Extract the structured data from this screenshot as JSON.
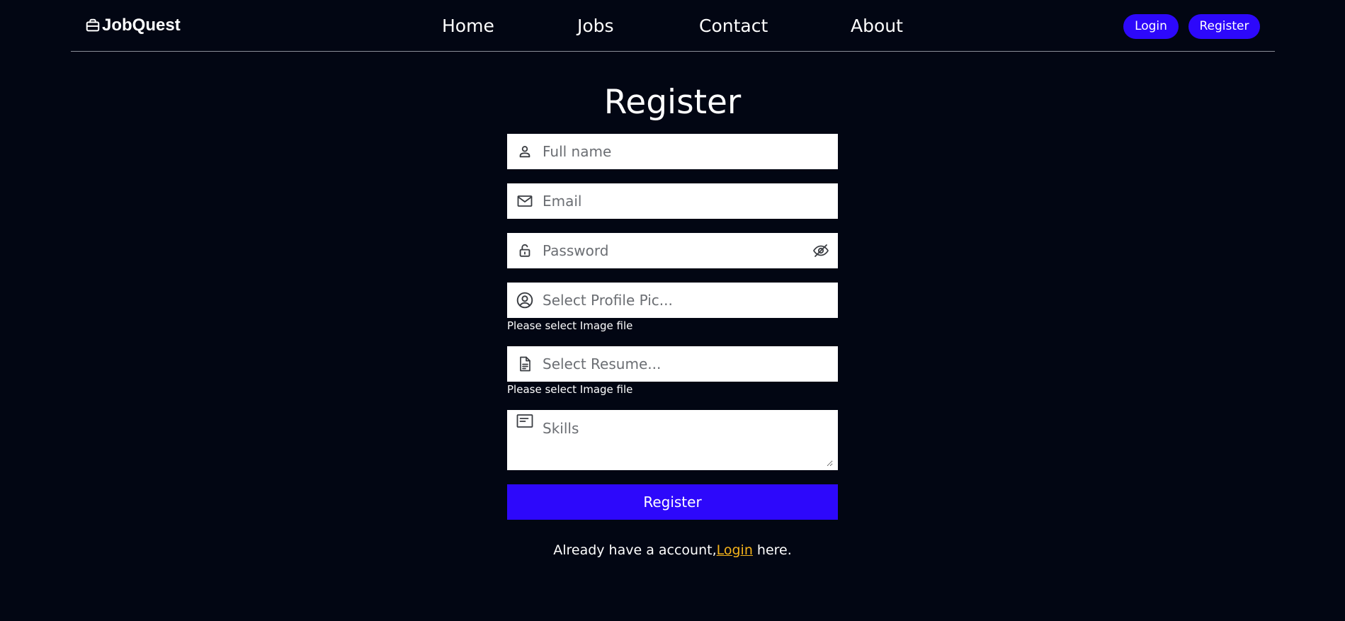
{
  "navbar": {
    "brand": "JobQuest",
    "links": [
      "Home",
      "Jobs",
      "Contact",
      "About"
    ],
    "login_label": "Login",
    "register_label": "Register"
  },
  "form": {
    "title": "Register",
    "full_name_placeholder": "Full name",
    "email_placeholder": "Email",
    "password_placeholder": "Password",
    "profile_pic_placeholder": "Select Profile Pic...",
    "profile_pic_hint": "Please select Image file",
    "resume_placeholder": "Select Resume...",
    "resume_hint": "Please select Image file",
    "skills_placeholder": "Skills",
    "submit_label": "Register",
    "footer_prefix": "Already have a account,",
    "footer_link": "Login",
    "footer_suffix": " here."
  },
  "colors": {
    "background": "#020613",
    "accent": "#2d08fb",
    "link": "#f5b31a"
  },
  "icons": {
    "brand": "briefcase-icon",
    "full_name": "user-icon",
    "email": "mail-icon",
    "password": "lock-icon",
    "password_toggle": "eye-off-icon",
    "profile_pic": "user-circle-icon",
    "resume": "file-text-icon",
    "skills": "note-icon"
  }
}
